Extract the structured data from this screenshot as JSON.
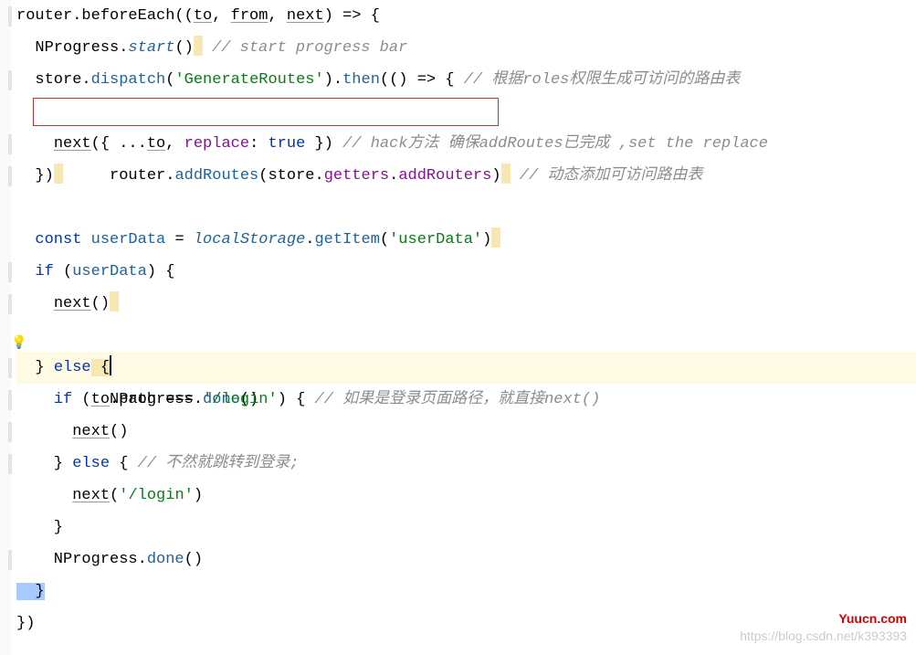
{
  "lines": {
    "l1_router": "router",
    "l1_beforeEach": ".beforeEach((",
    "l1_to": "to",
    "l1_sep1": ", ",
    "l1_from": "from",
    "l1_sep2": ", ",
    "l1_next": "next",
    "l1_tail": ") => {",
    "l2_pre": "  NProgress.",
    "l2_start": "start",
    "l2_call": "()",
    "l2_comment": " // start progress bar",
    "l3_pre": "  store.",
    "l3_dispatch": "dispatch",
    "l3_open": "(",
    "l3_str": "'GenerateRoutes'",
    "l3_close": ").",
    "l3_then": "then",
    "l3_tail": "(() => { ",
    "l3_comment": "// 根据roles权限生成可访问的路由表",
    "l4_pre": "    router.",
    "l4_addRoutes": "addRoutes",
    "l4_open": "(store.",
    "l4_getters": "getters",
    "l4_dot": ".",
    "l4_addRouters": "addRouters",
    "l4_close": ")",
    "l4_comment": " // 动态添加可访问路由表",
    "l5_pre": "    ",
    "l5_next": "next",
    "l5_open": "({ ...",
    "l5_to": "to",
    "l5_sep": ", ",
    "l5_replace": "replace",
    "l5_colon": ": ",
    "l5_true": "true",
    "l5_close": " }) ",
    "l5_comment": "// hack方法 确保addRoutes已完成 ,set the replace",
    "l6": "  })",
    "l8_pre": "  ",
    "l8_const": "const",
    "l8_sp": " ",
    "l8_userData": "userData",
    "l8_eq": " = ",
    "l8_localStorage": "localStorage",
    "l8_dot": ".",
    "l8_getItem": "getItem",
    "l8_open": "(",
    "l8_str": "'userData'",
    "l8_close": ")",
    "l9_pre": "  ",
    "l9_if": "if",
    "l9_sp": " (",
    "l9_userData": "userData",
    "l9_close": ") {",
    "l10_pre": "    ",
    "l10_next": "next",
    "l10_call": "()",
    "l11_pre": "    NProgress.",
    "l11_done": "done",
    "l11_call": "()",
    "l12_pre": "  } ",
    "l12_else": "else",
    "l12_brace": " {",
    "l13_pre": "    ",
    "l13_if": "if",
    "l13_open": " (",
    "l13_to": "to",
    "l13_path": ".path === ",
    "l13_str": "'/login'",
    "l13_close": ") { ",
    "l13_comment": "// 如果是登录页面路径，就直接next()",
    "l14_pre": "      ",
    "l14_next": "next",
    "l14_call": "()",
    "l15_pre": "    } ",
    "l15_else": "else",
    "l15_open": " { ",
    "l15_comment": "// 不然就跳转到登录;",
    "l16_pre": "      ",
    "l16_next": "next",
    "l16_open": "(",
    "l16_str": "'/login'",
    "l16_close": ")",
    "l17": "    }",
    "l18_pre": "    NProgress.",
    "l18_done": "done",
    "l18_call": "()",
    "l19": "  }",
    "l20": "})"
  },
  "watermark": {
    "red": "Yuucn.com",
    "grey": "https://blog.csdn.net/k393393"
  }
}
